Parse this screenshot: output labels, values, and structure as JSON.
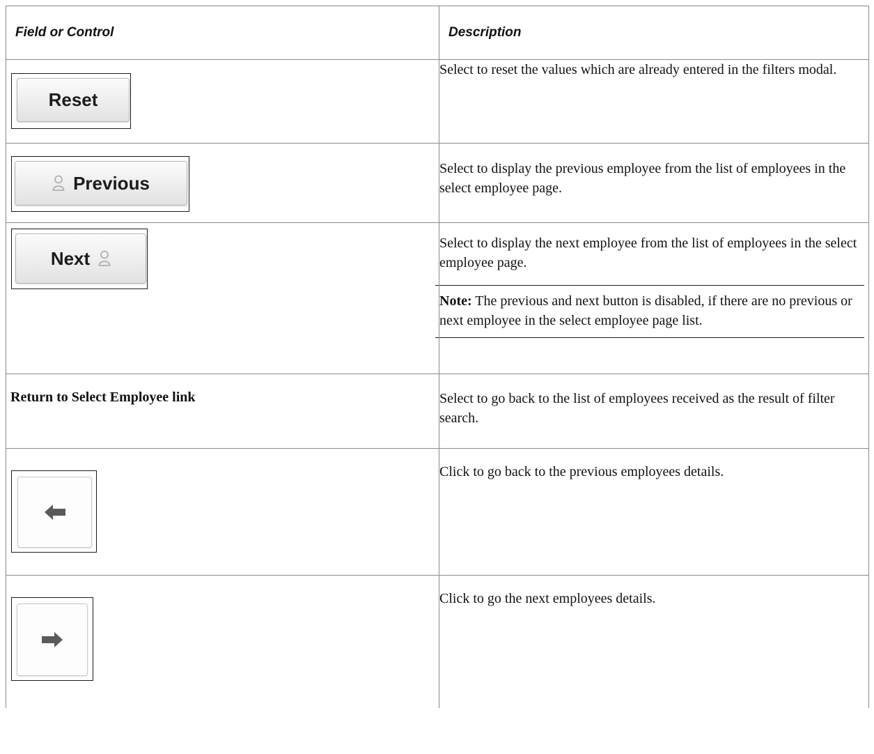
{
  "table": {
    "header": {
      "col1": "Field or Control",
      "col2": "Description"
    },
    "rows": [
      {
        "control": {
          "type": "button",
          "label": "Reset",
          "icon": ""
        },
        "description": "Select to reset the values which are already entered in the filters modal."
      },
      {
        "control": {
          "type": "button",
          "label": "Previous",
          "icon": "person-icon"
        },
        "description": "Select to display the previous employee from the list of employees in the select employee page."
      },
      {
        "control": {
          "type": "button",
          "label": "Next",
          "icon": "person-icon"
        },
        "description": "Select to display the next employee from the list of employees in the select employee page.",
        "note": {
          "label": "Note:",
          "text": " The previous and next button is disabled, if there are no previous or next employee in the select employee page list."
        }
      },
      {
        "control": {
          "type": "text",
          "label": "Return to Select Employee link"
        },
        "description": "Select to go back to the list of employees received as the result of filter search."
      },
      {
        "control": {
          "type": "icon-button",
          "icon": "left-arrow-icon"
        },
        "description": "Click to go back to the previous employees details."
      },
      {
        "control": {
          "type": "icon-button",
          "icon": "right-arrow-icon"
        },
        "description": "Click to go the next employees details."
      }
    ]
  },
  "colors": {
    "border": "#8a8a8a",
    "icon_gray": "#5a5a5a",
    "person_icon": "#b0b0b0"
  }
}
